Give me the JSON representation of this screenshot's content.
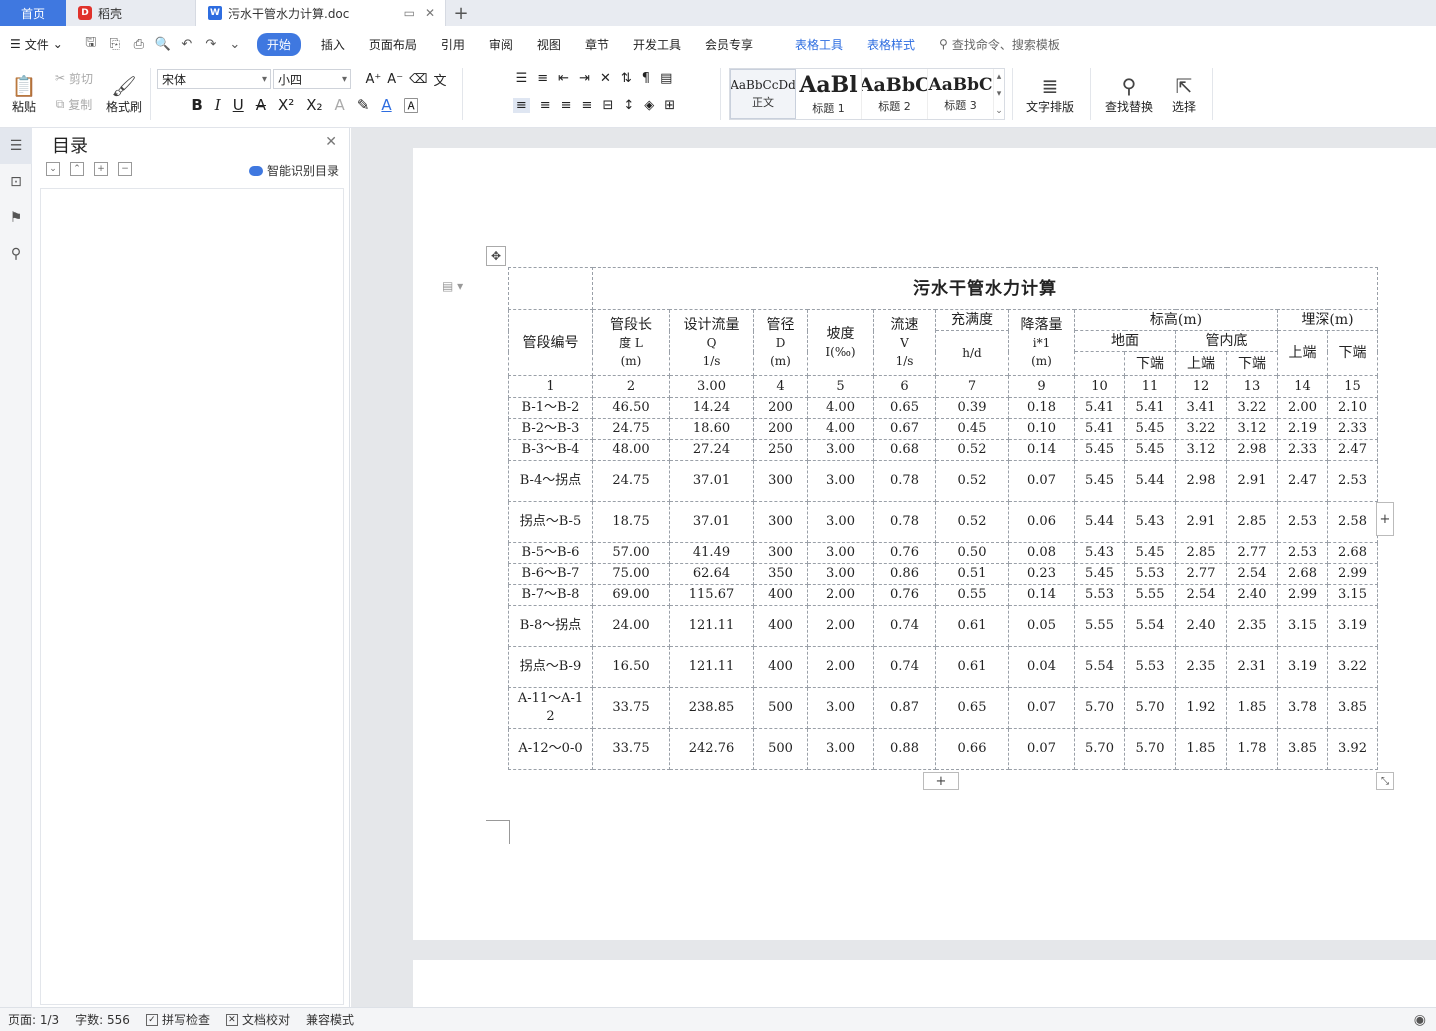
{
  "tabs": {
    "home": "首页",
    "daoke": "稻壳",
    "doc": "污水干管水力计算.doc"
  },
  "menu": {
    "file": "文件",
    "items": [
      "开始",
      "插入",
      "页面布局",
      "引用",
      "审阅",
      "视图",
      "章节",
      "开发工具",
      "会员专享"
    ],
    "table_tools": "表格工具",
    "table_style": "表格样式",
    "search": "查找命令、搜索模板"
  },
  "ribbon": {
    "paste": "粘贴",
    "cut": "剪切",
    "copy": "复制",
    "format_painter": "格式刷",
    "font": "宋体",
    "size": "小四",
    "styles": [
      {
        "sample": "AaBbCcDd",
        "name": "正文"
      },
      {
        "sample": "AaBl",
        "name": "标题 1"
      },
      {
        "sample": "AaBbC",
        "name": "标题 2"
      },
      {
        "sample": "AaBbC",
        "name": "标题 3"
      }
    ],
    "text_layout": "文字排版",
    "find_replace": "查找替换",
    "select": "选择"
  },
  "toc": {
    "title": "目录",
    "smart": "智能识别目录"
  },
  "table": {
    "title": "污水干管水力计算",
    "headers": {
      "seg_id": "管段编号",
      "length": [
        "管段长",
        "度 L",
        "(m)"
      ],
      "flow": [
        "设计流量",
        "Q",
        "1/s"
      ],
      "dia": [
        "管径",
        "D",
        "(m)"
      ],
      "slope": [
        "坡度",
        "I(‰)"
      ],
      "vel": [
        "流速",
        "V",
        "1/s"
      ],
      "fill": [
        "充满度",
        "h/d"
      ],
      "drop": [
        "降落量",
        "i*1",
        "(m)"
      ],
      "elev": "标高(m)",
      "ground": "地面",
      "invert": "管内底",
      "depth": "埋深(m)",
      "upper": "上端",
      "lower": "下端"
    },
    "numbers": [
      "1",
      "2",
      "3.00",
      "4",
      "5",
      "6",
      "7",
      "9",
      "10",
      "11",
      "12",
      "13",
      "14",
      "15"
    ],
    "rows": [
      {
        "id": "B-1～B-2",
        "tall": false,
        "v": [
          "46.50",
          "14.24",
          "200",
          "4.00",
          "0.65",
          "0.39",
          "0.18",
          "5.41",
          "5.41",
          "3.41",
          "3.22",
          "2.00",
          "2.10"
        ]
      },
      {
        "id": "B-2～B-3",
        "tall": false,
        "v": [
          "24.75",
          "18.60",
          "200",
          "4.00",
          "0.67",
          "0.45",
          "0.10",
          "5.41",
          "5.45",
          "3.22",
          "3.12",
          "2.19",
          "2.33"
        ]
      },
      {
        "id": "B-3～B-4",
        "tall": false,
        "v": [
          "48.00",
          "27.24",
          "250",
          "3.00",
          "0.68",
          "0.52",
          "0.14",
          "5.45",
          "5.45",
          "3.12",
          "2.98",
          "2.33",
          "2.47"
        ]
      },
      {
        "id": "B-4～拐点",
        "tall": true,
        "v": [
          "24.75",
          "37.01",
          "300",
          "3.00",
          "0.78",
          "0.52",
          "0.07",
          "5.45",
          "5.44",
          "2.98",
          "2.91",
          "2.47",
          "2.53"
        ]
      },
      {
        "id": "拐点～B-5",
        "tall": true,
        "v": [
          "18.75",
          "37.01",
          "300",
          "3.00",
          "0.78",
          "0.52",
          "0.06",
          "5.44",
          "5.43",
          "2.91",
          "2.85",
          "2.53",
          "2.58"
        ]
      },
      {
        "id": "B-5～B-6",
        "tall": false,
        "v": [
          "57.00",
          "41.49",
          "300",
          "3.00",
          "0.76",
          "0.50",
          "0.08",
          "5.43",
          "5.45",
          "2.85",
          "2.77",
          "2.53",
          "2.68"
        ]
      },
      {
        "id": "B-6～B-7",
        "tall": false,
        "v": [
          "75.00",
          "62.64",
          "350",
          "3.00",
          "0.86",
          "0.51",
          "0.23",
          "5.45",
          "5.53",
          "2.77",
          "2.54",
          "2.68",
          "2.99"
        ]
      },
      {
        "id": "B-7～B-8",
        "tall": false,
        "v": [
          "69.00",
          "115.67",
          "400",
          "2.00",
          "0.76",
          "0.55",
          "0.14",
          "5.53",
          "5.55",
          "2.54",
          "2.40",
          "2.99",
          "3.15"
        ]
      },
      {
        "id": "B-8～拐点",
        "tall": true,
        "v": [
          "24.00",
          "121.11",
          "400",
          "2.00",
          "0.74",
          "0.61",
          "0.05",
          "5.55",
          "5.54",
          "2.40",
          "2.35",
          "3.15",
          "3.19"
        ]
      },
      {
        "id": "拐点～B-9",
        "tall": true,
        "v": [
          "16.50",
          "121.11",
          "400",
          "2.00",
          "0.74",
          "0.61",
          "0.04",
          "5.54",
          "5.53",
          "2.35",
          "2.31",
          "3.19",
          "3.22"
        ]
      },
      {
        "id": "A-11～A-12",
        "tall": true,
        "v": [
          "33.75",
          "238.85",
          "500",
          "3.00",
          "0.87",
          "0.65",
          "0.07",
          "5.70",
          "5.70",
          "1.92",
          "1.85",
          "3.78",
          "3.85"
        ]
      },
      {
        "id": "A-12～0-0",
        "tall": true,
        "v": [
          "33.75",
          "242.76",
          "500",
          "3.00",
          "0.88",
          "0.66",
          "0.07",
          "5.70",
          "5.70",
          "1.85",
          "1.78",
          "3.85",
          "3.92"
        ]
      }
    ]
  },
  "status": {
    "page": "页面: 1/3",
    "words": "字数: 556",
    "spell": "拼写检查",
    "proof": "文档校对",
    "compat": "兼容模式"
  },
  "colors": {
    "accent": "#3f78e0",
    "link_blue": "#2e6de0"
  }
}
